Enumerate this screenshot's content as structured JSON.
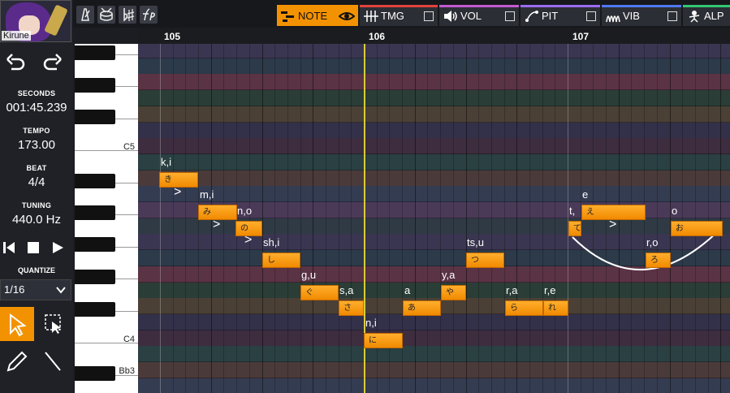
{
  "singer": {
    "name": "Kirune"
  },
  "history": {
    "undo_icon": "undo-icon",
    "redo_icon": "redo-icon"
  },
  "info": {
    "seconds_label": "SECONDS",
    "seconds_value": "001:45.239",
    "tempo_label": "TEMPO",
    "tempo_value": "173.00",
    "beat_label": "BEAT",
    "beat_value": "4/4",
    "tuning_label": "TUNING",
    "tuning_value": "440.0 Hz"
  },
  "quantize": {
    "label": "QUANTIZE",
    "value": "1/16"
  },
  "toolbar": {
    "tabs": [
      {
        "label": "NOTE"
      },
      {
        "label": "TMG"
      },
      {
        "label": "VOL"
      },
      {
        "label": "PIT"
      },
      {
        "label": "VIB"
      },
      {
        "label": "ALP"
      }
    ]
  },
  "piano": {
    "labels": [
      "C5",
      "C4",
      "Bb3"
    ]
  },
  "ruler": {
    "measures": [
      "105",
      "106",
      "107"
    ]
  },
  "notes": [
    {
      "lyric": "き",
      "phoneme": "k,i"
    },
    {
      "lyric": "み",
      "phoneme": "m,i"
    },
    {
      "lyric": "の",
      "phoneme": "n,o"
    },
    {
      "lyric": "し",
      "phoneme": "sh,i"
    },
    {
      "lyric": "ぐ",
      "phoneme": "g,u"
    },
    {
      "lyric": "さ",
      "phoneme": "s,a"
    },
    {
      "lyric": "に",
      "phoneme": "n,i"
    },
    {
      "lyric": "あ",
      "phoneme": "a"
    },
    {
      "lyric": "や",
      "phoneme": "y,a"
    },
    {
      "lyric": "つ",
      "phoneme": "ts,u"
    },
    {
      "lyric": "ら",
      "phoneme": "r,a"
    },
    {
      "lyric": "れ",
      "phoneme": "r,e"
    },
    {
      "lyric": "て",
      "phoneme": "t,"
    },
    {
      "lyric": "え",
      "phoneme": "e"
    },
    {
      "lyric": "ろ",
      "phoneme": "r,o"
    },
    {
      "lyric": "お",
      "phoneme": "o"
    }
  ]
}
